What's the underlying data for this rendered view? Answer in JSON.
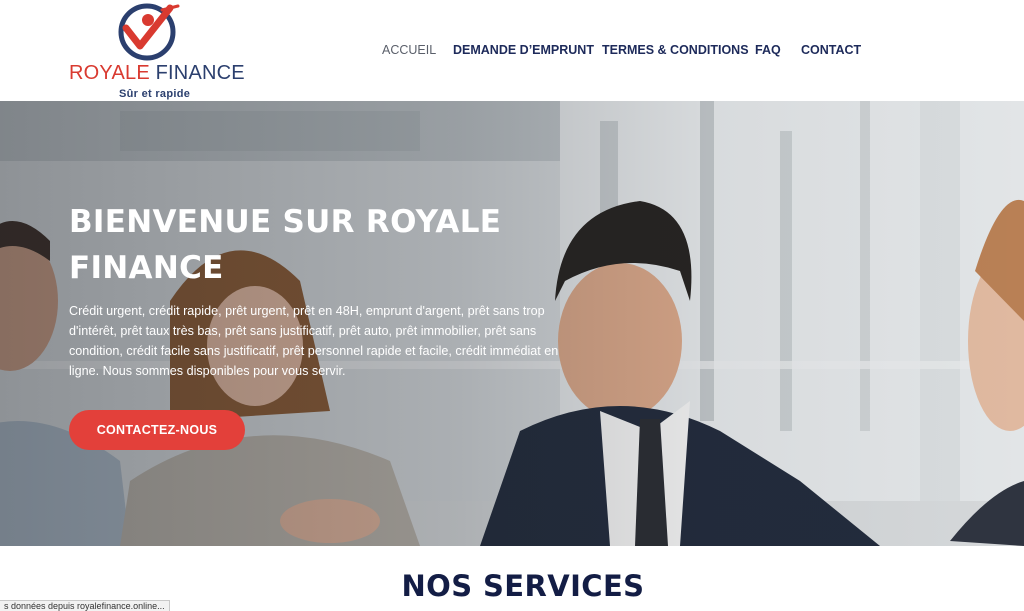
{
  "brand": {
    "name_part1": "ROYALE",
    "name_part2": "FINANCE",
    "tagline": "Sûr et rapide",
    "colors": {
      "red": "#d93a30",
      "navy": "#2b3f6e"
    }
  },
  "nav": {
    "items": [
      {
        "label": "ACCUEIL",
        "active": true
      },
      {
        "label": "DEMANDE D’EMPRUNT",
        "active": false
      },
      {
        "label": "TERMES & CONDITIONS",
        "active": false
      },
      {
        "label": "FAQ",
        "active": false
      },
      {
        "label": "CONTACT",
        "active": false
      }
    ]
  },
  "hero": {
    "title": "BIENVENUE SUR ROYALE FINANCE",
    "text": "Crédit urgent, crédit rapide, prêt urgent, prêt en 48H, emprunt d'argent, prêt sans trop d'intérêt, prêt taux très bas, prêt sans justificatif, prêt auto, prêt immobilier, prêt sans condition, crédit facile sans justificatif, prêt personnel rapide et facile, crédit immédiat en ligne. Nous sommes disponibles pour vous servir.",
    "cta_label": "CONTACTEZ-NOUS",
    "cta_color": "#e3403a"
  },
  "services": {
    "title": "NOS SERVICES"
  },
  "status_bar": {
    "text": "s données depuis royalefinance.online..."
  }
}
